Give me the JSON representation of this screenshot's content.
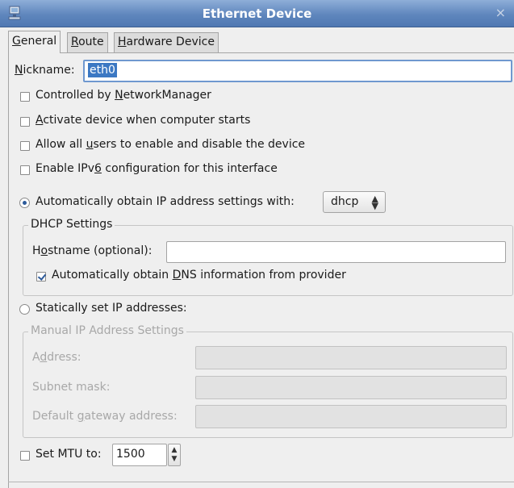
{
  "window": {
    "title": "Ethernet Device",
    "icon": "network-device-icon",
    "close_glyph": "×"
  },
  "tabs": [
    {
      "pre": "",
      "key": "G",
      "post": "eneral"
    },
    {
      "pre": "",
      "key": "R",
      "post": "oute"
    },
    {
      "pre": "",
      "key": "H",
      "post": "ardware Device"
    }
  ],
  "nickname": {
    "label_key": "N",
    "label_rest": "ickname:",
    "value": "eth0"
  },
  "checkboxes": {
    "networkmanager": {
      "pre": "Controlled by ",
      "key": "N",
      "post": "etworkManager",
      "checked": false
    },
    "activate": {
      "pre": "",
      "key": "A",
      "post": "ctivate device when computer starts",
      "checked": false
    },
    "allow_users": {
      "pre": "Allow all ",
      "key": "u",
      "post": "sers to enable and disable the device",
      "checked": false
    },
    "ipv6": {
      "pre": "Enable IPv",
      "key": "6",
      "post": " configuration for this interface",
      "checked": false
    }
  },
  "auto_ip": {
    "label": "Automatically obtain IP address settings with:",
    "selected": true,
    "method": "dhcp"
  },
  "dhcp": {
    "frame_title": "DHCP Settings",
    "hostname_pre": "H",
    "hostname_key": "o",
    "hostname_post": "stname (optional):",
    "hostname_value": "",
    "dns_pre": "Automatically obtain ",
    "dns_key": "D",
    "dns_post": "NS information from provider",
    "dns_checked": true
  },
  "static_ip": {
    "label": "Statically set IP addresses:",
    "selected": false
  },
  "manual": {
    "frame_title": "Manual IP Address Settings",
    "address_pre": "A",
    "address_key": "d",
    "address_post": "dress:",
    "subnet_label": "Subnet mask:",
    "gateway_pre": "Default ",
    "gateway_key": "g",
    "gateway_post": "ateway address:"
  },
  "mtu": {
    "label": "Set MTU to:",
    "value": "1500",
    "checked": false
  },
  "colors": {
    "titlebar": "#5f86bd",
    "selection": "#3c78c3",
    "focus_border": "#6f98cf"
  }
}
